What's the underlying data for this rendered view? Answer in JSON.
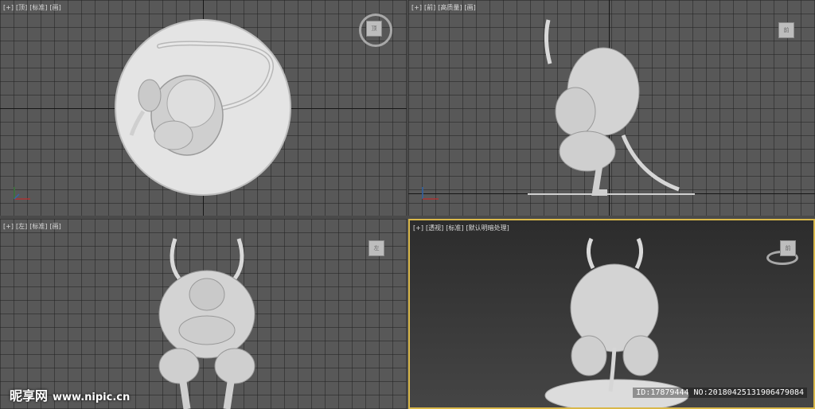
{
  "viewports": {
    "top": {
      "plus": "[+]",
      "view": "[顶]",
      "mode": "[标准]",
      "shading": "[画]"
    },
    "front": {
      "plus": "[+]",
      "view": "[前]",
      "mode": "[高质量]",
      "shading": "[画]"
    },
    "left": {
      "plus": "[+]",
      "view": "[左]",
      "mode": "[标准]",
      "shading": "[画]"
    },
    "persp": {
      "plus": "[+]",
      "view": "[透视]",
      "mode": "[标准]",
      "shading": "[默认明暗处理]"
    }
  },
  "viewcube": {
    "top": "顶",
    "front": "前",
    "left": "左",
    "persp": "前"
  },
  "watermark": {
    "brand": "昵享网",
    "url": "www.nipic.cn"
  },
  "image_id": "ID:17879444 NO:20180425131906479084",
  "colors": {
    "active_border": "#d9b84a",
    "model": "#d6d6d6",
    "grid_bg": "#585858"
  },
  "icons": [
    "viewcube-icon",
    "compass-ring-icon",
    "axis-triad-icon"
  ]
}
